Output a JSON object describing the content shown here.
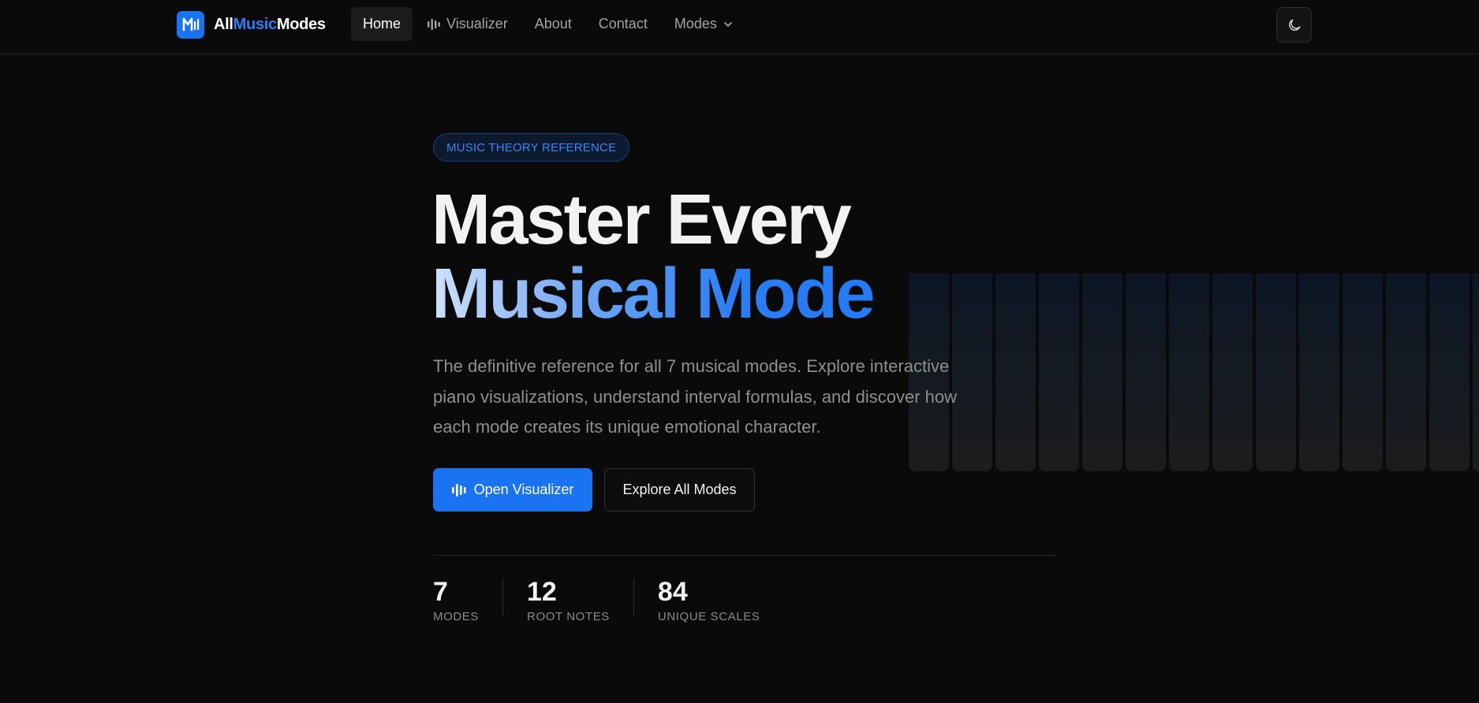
{
  "nav": {
    "logo": {
      "mark": "M",
      "part1": "All",
      "part2": "Music",
      "part3": "Modes"
    },
    "links": [
      {
        "label": "Home",
        "active": true
      },
      {
        "label": "Visualizer",
        "icon": "audio-bars-icon"
      },
      {
        "label": "About"
      },
      {
        "label": "Contact"
      },
      {
        "label": "Modes",
        "icon": "chevron-down-icon"
      }
    ],
    "theme_toggle_icon": "moon-icon"
  },
  "hero": {
    "badge": "MUSIC THEORY REFERENCE",
    "title_line1": "Master Every",
    "title_line2": "Musical Mode",
    "lead": "The definitive reference for all 7 musical modes. Explore interactive piano visualizations, understand interval formulas, and discover how each mode creates its unique emotional character.",
    "primary_button": "Open Visualizer",
    "secondary_button": "Explore All Modes"
  },
  "stats": [
    {
      "value": "7",
      "label": "MODES"
    },
    {
      "value": "12",
      "label": "ROOT NOTES"
    },
    {
      "value": "84",
      "label": "UNIQUE SCALES"
    }
  ],
  "colors": {
    "accent": "#1a73f0",
    "background": "#0a0a0a",
    "muted_text": "#8f8f8f"
  }
}
